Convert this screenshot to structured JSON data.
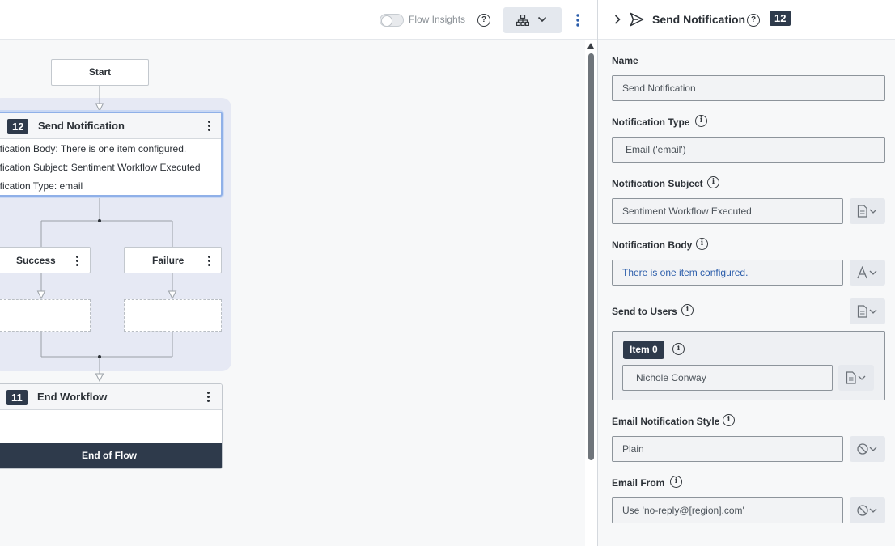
{
  "topbar": {
    "insights_label": "Flow Insights",
    "insights_enabled": false
  },
  "flow": {
    "start_label": "Start",
    "send_node": {
      "number": "12",
      "title": "Send Notification",
      "details": [
        "ification Body: There is one item configured.",
        "ification Subject: Sentiment Workflow Executed",
        "ification Type: email"
      ]
    },
    "branches": {
      "success": "Success",
      "failure": "Failure"
    },
    "end_node": {
      "number": "11",
      "title": "End Workflow",
      "footer": "End of Flow"
    }
  },
  "panel": {
    "title": "Send Notification",
    "badge": "12",
    "fields": {
      "name": {
        "label": "Name",
        "value": "Send Notification"
      },
      "notification_type": {
        "label": "Notification Type",
        "value": "Email ('email')"
      },
      "notification_subject": {
        "label": "Notification Subject",
        "value": "Sentiment Workflow Executed"
      },
      "notification_body": {
        "label": "Notification Body",
        "value": "There is one item configured."
      },
      "send_to_users": {
        "label": "Send to Users",
        "item_label": "Item 0",
        "item_value": "Nichole Conway"
      },
      "email_style": {
        "label": "Email Notification Style",
        "value": "Plain"
      },
      "email_from": {
        "label": "Email From",
        "value": "Use 'no-reply@[region].com'"
      }
    }
  },
  "colors": {
    "accent_navy": "#2e3a4b",
    "selection_blue": "#8fb0e8",
    "group_background": "#e6e9f4",
    "link_blue": "#2a5caa"
  }
}
